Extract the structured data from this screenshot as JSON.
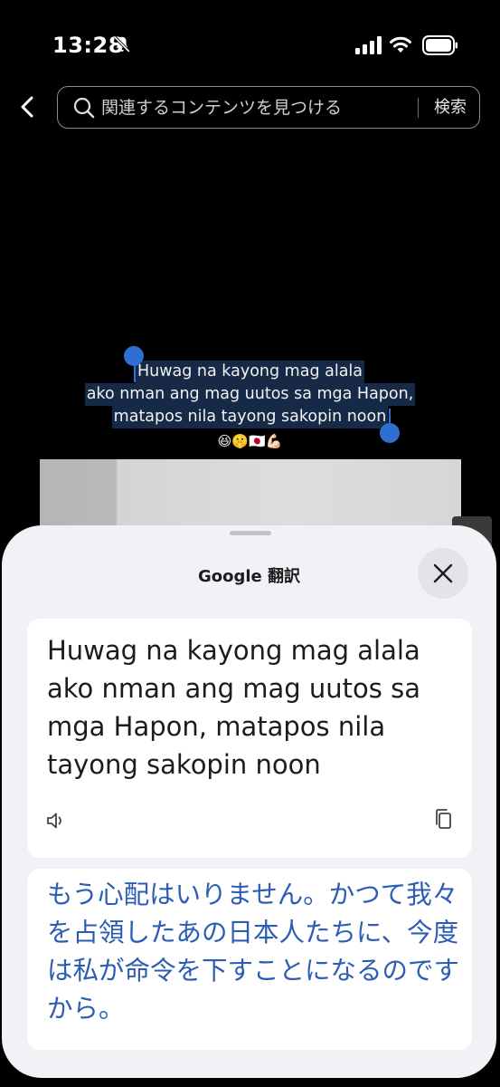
{
  "status_bar": {
    "time": "13:28"
  },
  "search": {
    "placeholder": "関連するコンテンツを見つける",
    "submit_label": "検索"
  },
  "caption": {
    "line1": "Huwag na kayong mag alala",
    "line2": "ako nman ang mag uutos sa mga Hapon,",
    "line3": "matapos nila tayong sakopin noon",
    "emojis": "😆🤫🇯🇵💪🏻"
  },
  "translate_sheet": {
    "title": "Google 翻訳",
    "source_text": "Huwag na kayong mag alala ako nman ang mag uutos sa mga Hapon, matapos nila tayong sakopin noon",
    "translated_text": "もう心配はいりません。かつて我々を占領したあの日本人たちに、今度は私が命令を下すことになるのですから。",
    "accent_color": "#2c5cb4"
  }
}
